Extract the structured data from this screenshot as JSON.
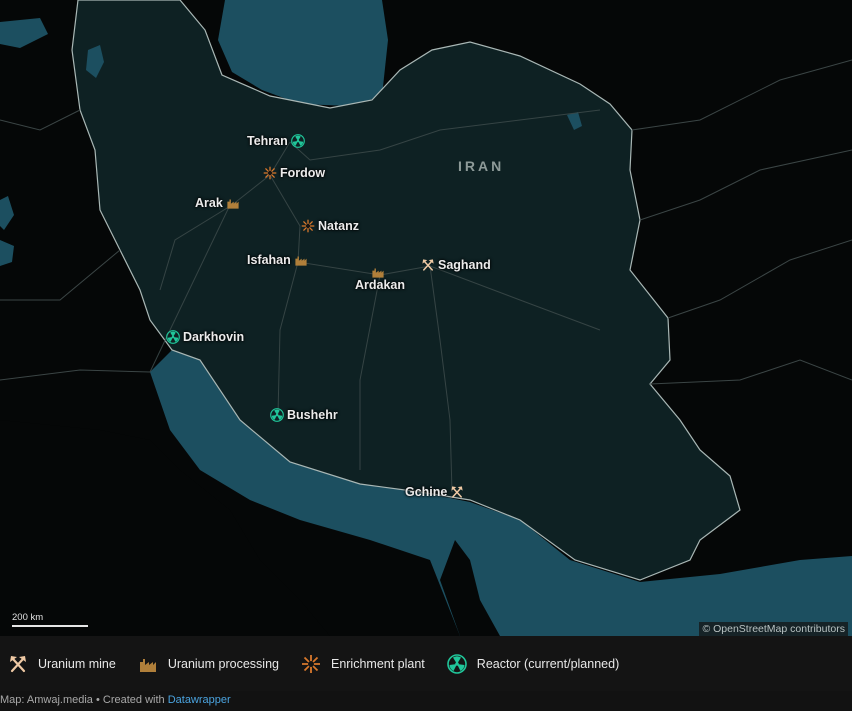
{
  "country_label": "IRAN",
  "colors": {
    "water": "#1c4f60",
    "iran_fill": "#0e2123",
    "land": "#050707",
    "mine": "#efc9a4",
    "processing": "#b07f3a",
    "enrichment": "#d9782c",
    "reactor": "#20c69a"
  },
  "sites": [
    {
      "name": "Tehran",
      "type": "reactor"
    },
    {
      "name": "Fordow",
      "type": "enrichment"
    },
    {
      "name": "Arak",
      "type": "processing"
    },
    {
      "name": "Natanz",
      "type": "enrichment"
    },
    {
      "name": "Isfahan",
      "type": "processing"
    },
    {
      "name": "Ardakan",
      "type": "processing"
    },
    {
      "name": "Saghand",
      "type": "mine"
    },
    {
      "name": "Darkhovin",
      "type": "reactor"
    },
    {
      "name": "Bushehr",
      "type": "reactor"
    },
    {
      "name": "Gchine",
      "type": "mine"
    }
  ],
  "scale": {
    "label": "200 km"
  },
  "attribution": "© OpenStreetMap contributors",
  "legend": [
    {
      "label": "Uranium mine",
      "icon": "hammer-pick-icon"
    },
    {
      "label": "Uranium processing",
      "icon": "factory-icon"
    },
    {
      "label": "Enrichment plant",
      "icon": "centrifuge-icon"
    },
    {
      "label": "Reactor (current/planned)",
      "icon": "radiation-icon"
    }
  ],
  "footer": {
    "prefix": "Map: Amwaj.media • Created with ",
    "link": "Datawrapper"
  }
}
